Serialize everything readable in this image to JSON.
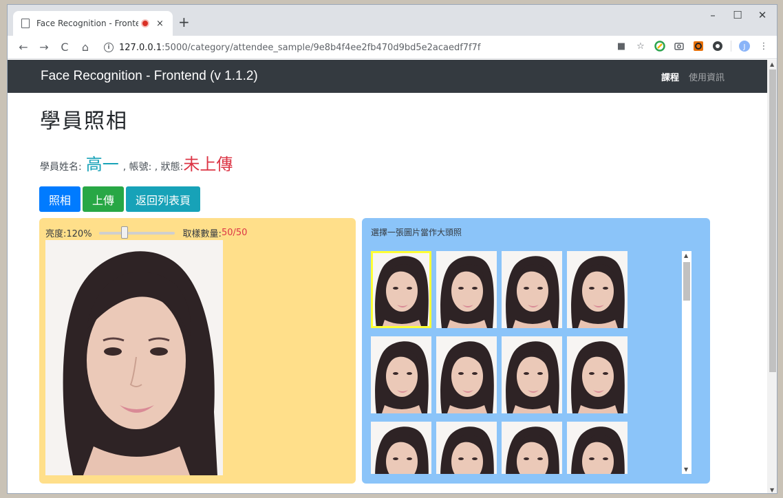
{
  "browser": {
    "tab_title": "Face Recognition - Fronten",
    "tab_close": "×",
    "new_tab": "+",
    "window_controls": {
      "minimize": "–",
      "maximize": "☐",
      "close": "✕"
    },
    "url_host": "127.0.0.1",
    "url_path": ":5000/category/attendee_sample/9e8b4f4ee2fb470d9bd5e2acaedf7f7f",
    "nav_icons": {
      "back": "←",
      "forward": "→",
      "reload": "C",
      "home": "⌂"
    },
    "extensions": [
      "camera-icon",
      "star-icon",
      "chrome-ext-icon",
      "screenshot-icon",
      "red-ext-icon",
      "shield-ext-icon",
      "profile-icon",
      "menu-icon"
    ],
    "profile_initial": "J",
    "colors": {
      "tab_bar": "#dee1e6",
      "recording": "#d93025"
    }
  },
  "navbar": {
    "brand": "Face Recognition - Frontend (v 1.1.2)",
    "links": [
      {
        "label": "課程",
        "active": true
      },
      {
        "label": "使用資訊",
        "active": false
      }
    ]
  },
  "page": {
    "title": "學員照相",
    "info": {
      "name_label": "學員姓名:",
      "name_value": "高一",
      "account_label": ", 帳號: , 狀態:",
      "status_value": "未上傳"
    },
    "buttons": {
      "photo": "照相",
      "upload": "上傳",
      "back": "返回列表頁"
    },
    "camera": {
      "brightness_label": "亮度:120%",
      "brightness_percent": 120,
      "sample_label": "取樣數量:",
      "sample_value": "50/50"
    },
    "selection": {
      "title": "選擇一張圖片當作大頭照",
      "thumbnail_count_visible": 12,
      "selected_index": 0
    }
  },
  "colors": {
    "navbar_bg": "#343a40",
    "camera_panel": "#ffdf8a",
    "selection_panel": "#8bc4f9",
    "selected_outline": "#ffff33",
    "name_color": "#17a2b8",
    "status_color": "#dc3545"
  }
}
